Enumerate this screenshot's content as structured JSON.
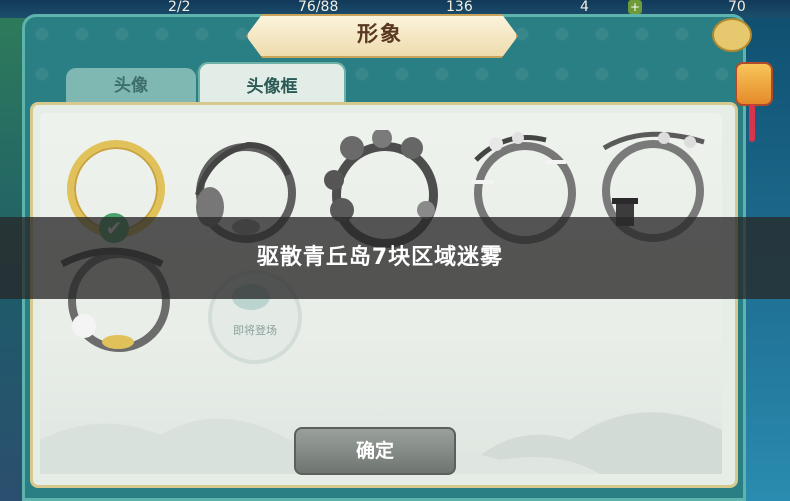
{
  "topbar": {
    "counter_a": "2/2",
    "counter_b": "76/88",
    "counter_c": "136",
    "counter_d": "4",
    "counter_e": "70"
  },
  "title": "形象",
  "tabs": [
    {
      "label": "头像",
      "active": false
    },
    {
      "label": "头像框",
      "active": true
    }
  ],
  "frames": [
    {
      "name": "gold-ring",
      "selected": true
    },
    {
      "name": "branch-frame",
      "selected": false
    },
    {
      "name": "blossom-frame",
      "selected": false
    },
    {
      "name": "snow-plum-frame",
      "selected": false
    },
    {
      "name": "lantern-frame",
      "selected": false
    },
    {
      "name": "bridge-frame",
      "selected": false
    }
  ],
  "coming_soon": "即将登场",
  "banner_text": "驱散青丘岛7块区域迷雾",
  "confirm_label": "确定",
  "colors": {
    "accent_teal": "#2a7f84",
    "gold": "#e1c25a",
    "confirm_gray": "#7d837f"
  }
}
